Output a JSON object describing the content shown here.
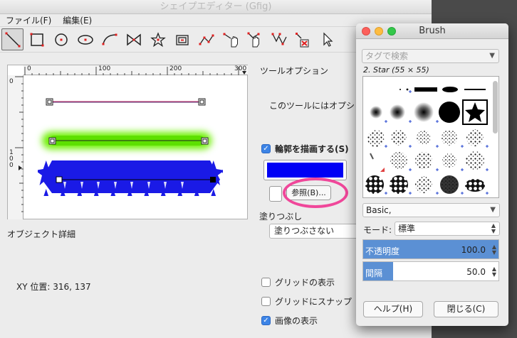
{
  "window_title": "シェイプエディター (Gfig)",
  "menu": [
    "ファイル(F)",
    "編集(E)"
  ],
  "toolbar_tools": [
    "line-tool-icon",
    "rectangle-tool-icon",
    "circle-tool-icon",
    "ellipse-tool-icon",
    "arc-tool-icon",
    "polygon-tool-icon",
    "star-tool-icon",
    "spiral-tool-icon",
    "bezier-tool-icon",
    "move-object-icon",
    "move-point-icon",
    "copy-object-icon",
    "delete-object-icon",
    "select-object-icon"
  ],
  "ruler": {
    "h_ticks": [
      "0",
      "100",
      "200",
      "300"
    ],
    "v_ticks": [
      "0",
      "1",
      "0",
      "0"
    ]
  },
  "tool_options": {
    "title": "ツールオプション",
    "message": "このツールにはオプシ"
  },
  "stroke": {
    "label": "輪郭を描画する(S)",
    "color": "#0000f5",
    "browse_label": "参照(B)..."
  },
  "fill": {
    "label": "塗りつぶし",
    "value": "塗りつぶさない"
  },
  "object_details": "オブジェクト詳細",
  "xy_position": "XY 位置:  316, 137",
  "checkboxes": {
    "show_grid": "グリッドの表示",
    "snap_grid": "グリッドにスナップ",
    "show_image": "画像の表示"
  },
  "brush_dialog": {
    "title": "Brush",
    "tag_placeholder": "タグで検索",
    "selected_brush": "2. Star (55 × 55)",
    "brush_set": "Basic,",
    "mode_label": "モード:",
    "mode_value": "標準",
    "opacity_label": "不透明度",
    "opacity_value": "100.0",
    "opacity_fraction": 1.0,
    "spacing_label": "間隔",
    "spacing_value": "50.0",
    "spacing_fraction": 0.22,
    "help_button": "ヘルプ(H)",
    "close_button": "閉じる(C)"
  },
  "colors": {
    "accent": "#3d84e6",
    "highlight": "#f0479a",
    "green_glow": "#6cf000"
  }
}
